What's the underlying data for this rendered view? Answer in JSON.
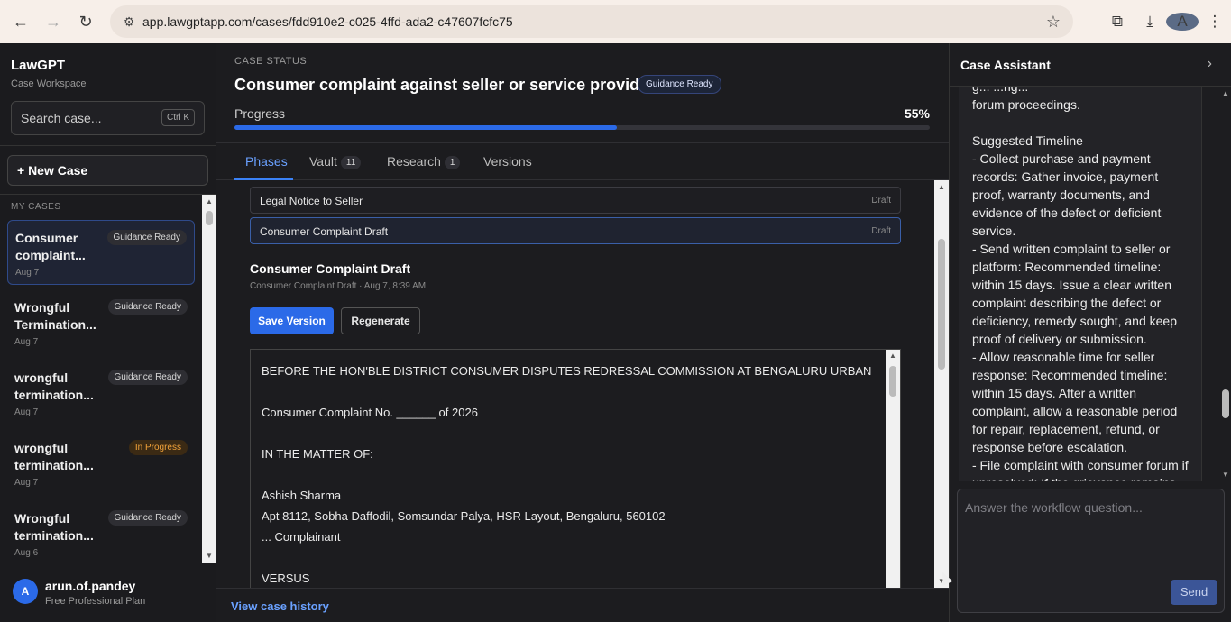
{
  "browser": {
    "url": "app.lawgptapp.com/cases/fdd910e2-c025-4ffd-ada2-c47607fcfc75",
    "profile_initial": "A"
  },
  "sidebar": {
    "brand": "LawGPT",
    "subtitle": "Case Workspace",
    "search_placeholder": "Search case...",
    "search_shortcut": "Ctrl K",
    "new_case_label": "+ New Case",
    "section_label": "MY CASES",
    "cases": [
      {
        "title": "Consumer complaint...",
        "date": "Aug 7",
        "badge": "Guidance Ready",
        "active": true
      },
      {
        "title": "Wrongful Termination...",
        "date": "Aug 7",
        "badge": "Guidance Ready"
      },
      {
        "title": "wrongful termination...",
        "date": "Aug 7",
        "badge": "Guidance Ready"
      },
      {
        "title": "wrongful termination...",
        "date": "Aug 7",
        "badge": "In Progress"
      },
      {
        "title": "Wrongful termination...",
        "date": "Aug 6",
        "badge": "Guidance Ready"
      }
    ],
    "user": {
      "initial": "A",
      "name": "arun.of.pandey",
      "plan": "Free Professional Plan"
    }
  },
  "main": {
    "case_status_label": "CASE STATUS",
    "title": "Consumer complaint against seller or service provider",
    "status_badge": "Guidance Ready",
    "progress_label": "Progress",
    "progress_value": "55%",
    "progress_fraction": 0.55,
    "tabs": [
      {
        "label": "Phases"
      },
      {
        "label": "Vault",
        "count": "11"
      },
      {
        "label": "Research",
        "count": "1"
      },
      {
        "label": "Versions"
      }
    ],
    "phases": [
      {
        "name": "Legal Notice to Seller",
        "status": "Draft"
      },
      {
        "name": "Consumer Complaint Draft",
        "status": "Draft"
      }
    ],
    "draft": {
      "title": "Consumer Complaint Draft",
      "meta": "Consumer Complaint Draft · Aug 7, 8:39 AM",
      "save_label": "Save Version",
      "regen_label": "Regenerate",
      "body": "BEFORE THE HON'BLE DISTRICT CONSUMER DISPUTES REDRESSAL COMMISSION AT BENGALURU URBAN\n\nConsumer Complaint No. ______ of 2026\n\nIN THE MATTER OF:\n\nAshish Sharma\nApt 8112, Sobha Daffodil, Somsundar Palya, HSR Layout, Bengaluru, 560102\n... Complainant\n\nVERSUS"
    },
    "history_link": "View case history"
  },
  "assistant": {
    "title": "Case Assistant",
    "message": "g... ...ng...\nforum proceedings.\n\nSuggested Timeline\n- Collect purchase and payment records: Gather invoice, payment proof, warranty documents, and evidence of the defect or deficient service.\n- Send written complaint to seller or platform: Recommended timeline: within 15 days. Issue a clear written complaint describing the defect or deficiency, remedy sought, and keep proof of delivery or submission.\n- Allow reasonable time for seller response: Recommended timeline: within 15 days. After a written complaint, allow a reasonable period for repair, replacement, refund, or response before escalation.\n- File complaint with consumer forum if unresolved: If the grievance remains",
    "input_placeholder": "Answer the workflow question...",
    "send_label": "Send"
  }
}
